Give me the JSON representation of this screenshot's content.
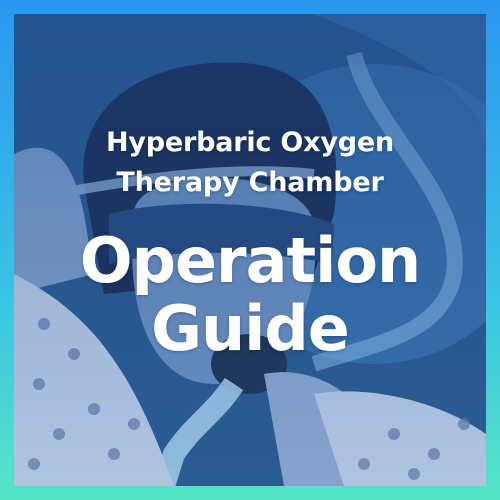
{
  "subtitle_lines": [
    "Hyperbaric Oxygen",
    "Therapy Chamber"
  ],
  "headline_lines": [
    "Operation",
    "Guide"
  ],
  "colors": {
    "border_top": "#2a96f0",
    "border_bottom": "#55e6c6",
    "photo_tint": "#2a5d95",
    "text": "#ffffff"
  }
}
